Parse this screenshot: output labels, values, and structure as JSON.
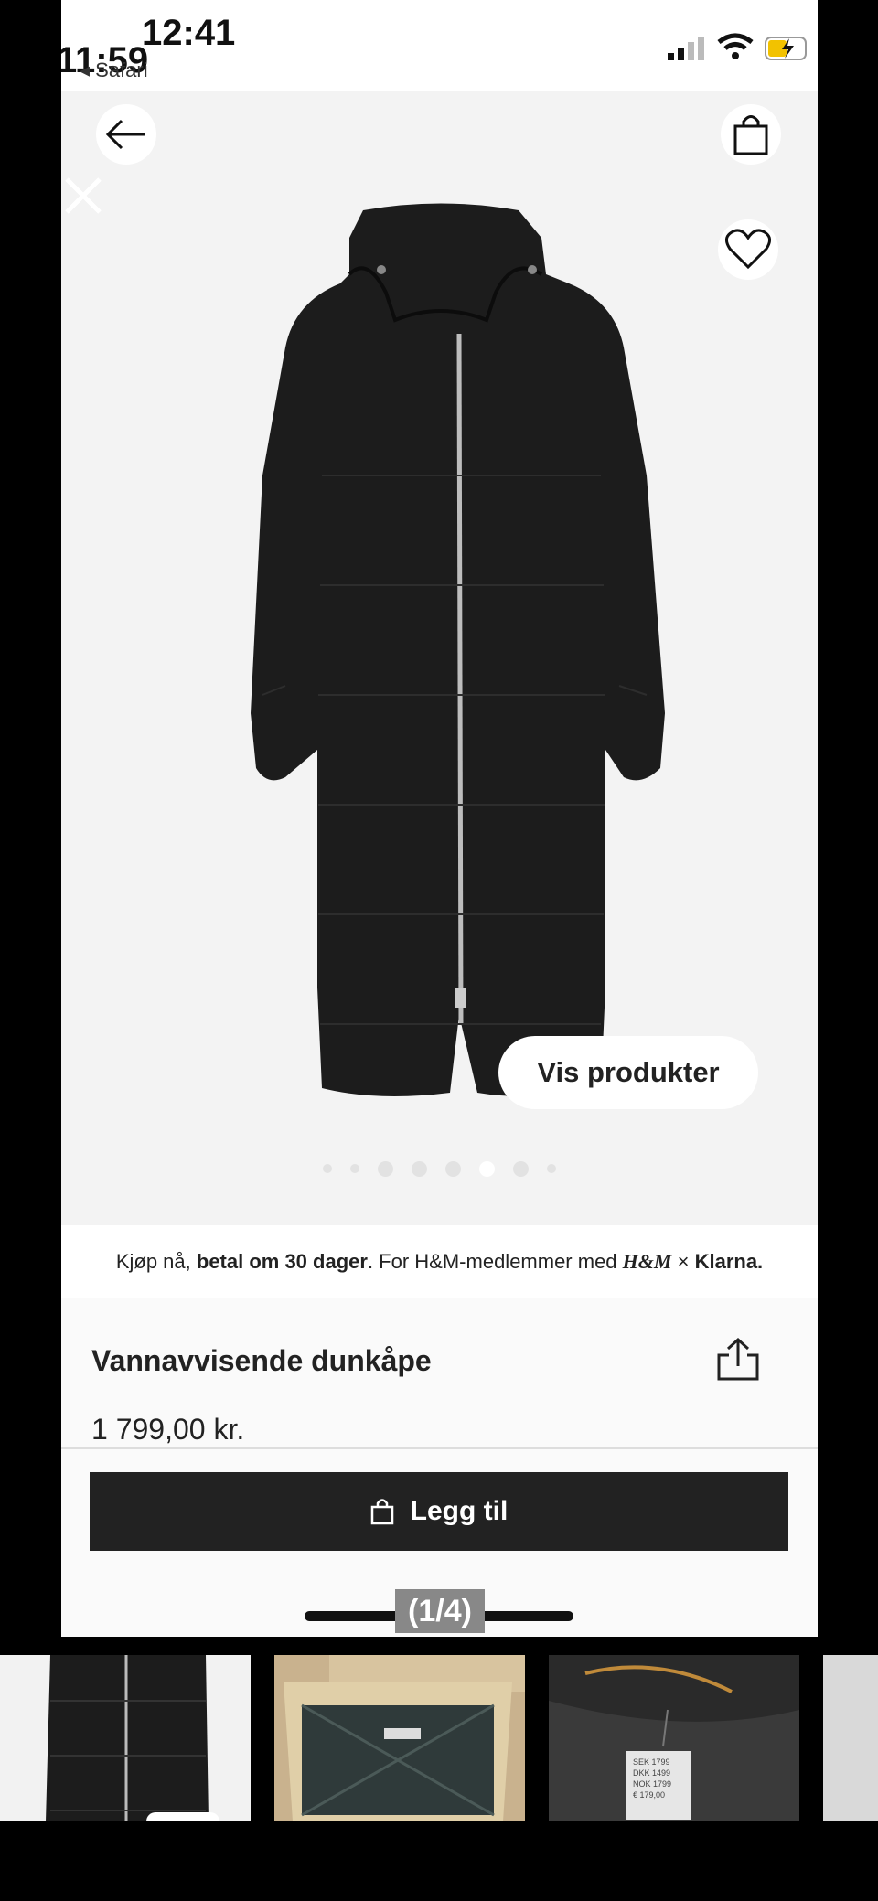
{
  "outer_status": {
    "time": "12:41"
  },
  "inner_status": {
    "time": "11:59",
    "back_app": "◂ Safari"
  },
  "product": {
    "vis_button": "Vis produkter",
    "klarna": {
      "prefix": "Kjøp nå, ",
      "bold": "betal om 30 dager",
      "suffix": ". For H&M-medlemmer med ",
      "hm_logo": "H&M",
      "times": "×",
      "klarna_logo": "Klarna."
    },
    "title": "Vannavvisende dunkåpe",
    "price": "1 799,00 kr.",
    "add_button": "Legg til",
    "image_dots": 8,
    "active_dot": 5
  },
  "viewer": {
    "counter": "(1/4)"
  },
  "thumb3_tag": {
    "lines": [
      "SEK 1799",
      "DKK 1499",
      "NOK 1799",
      "€ 179,00"
    ]
  },
  "colors": {
    "button_bg": "#222222",
    "coat": "#1c1c1c"
  }
}
